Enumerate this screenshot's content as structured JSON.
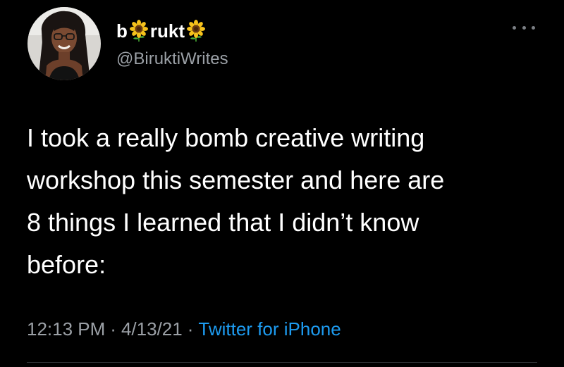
{
  "tweet": {
    "author": {
      "name_part1": "b",
      "name_part2": "rukt",
      "name_emoji": "sunflower",
      "handle": "@BiruktiWrites"
    },
    "more_icon": "ellipsis-icon",
    "text_lines": [
      "I took a really bomb creative writing",
      "workshop this semester and here are",
      "8 things I learned that I didn’t know",
      "before:"
    ],
    "time": "12:13 PM",
    "date": "4/13/21",
    "separator": "·",
    "source": "Twitter for iPhone"
  },
  "colors": {
    "background": "#000000",
    "text": "#ffffff",
    "secondary": "#9ba0a6",
    "link": "#1d9bf0",
    "divider": "#2f3336"
  }
}
